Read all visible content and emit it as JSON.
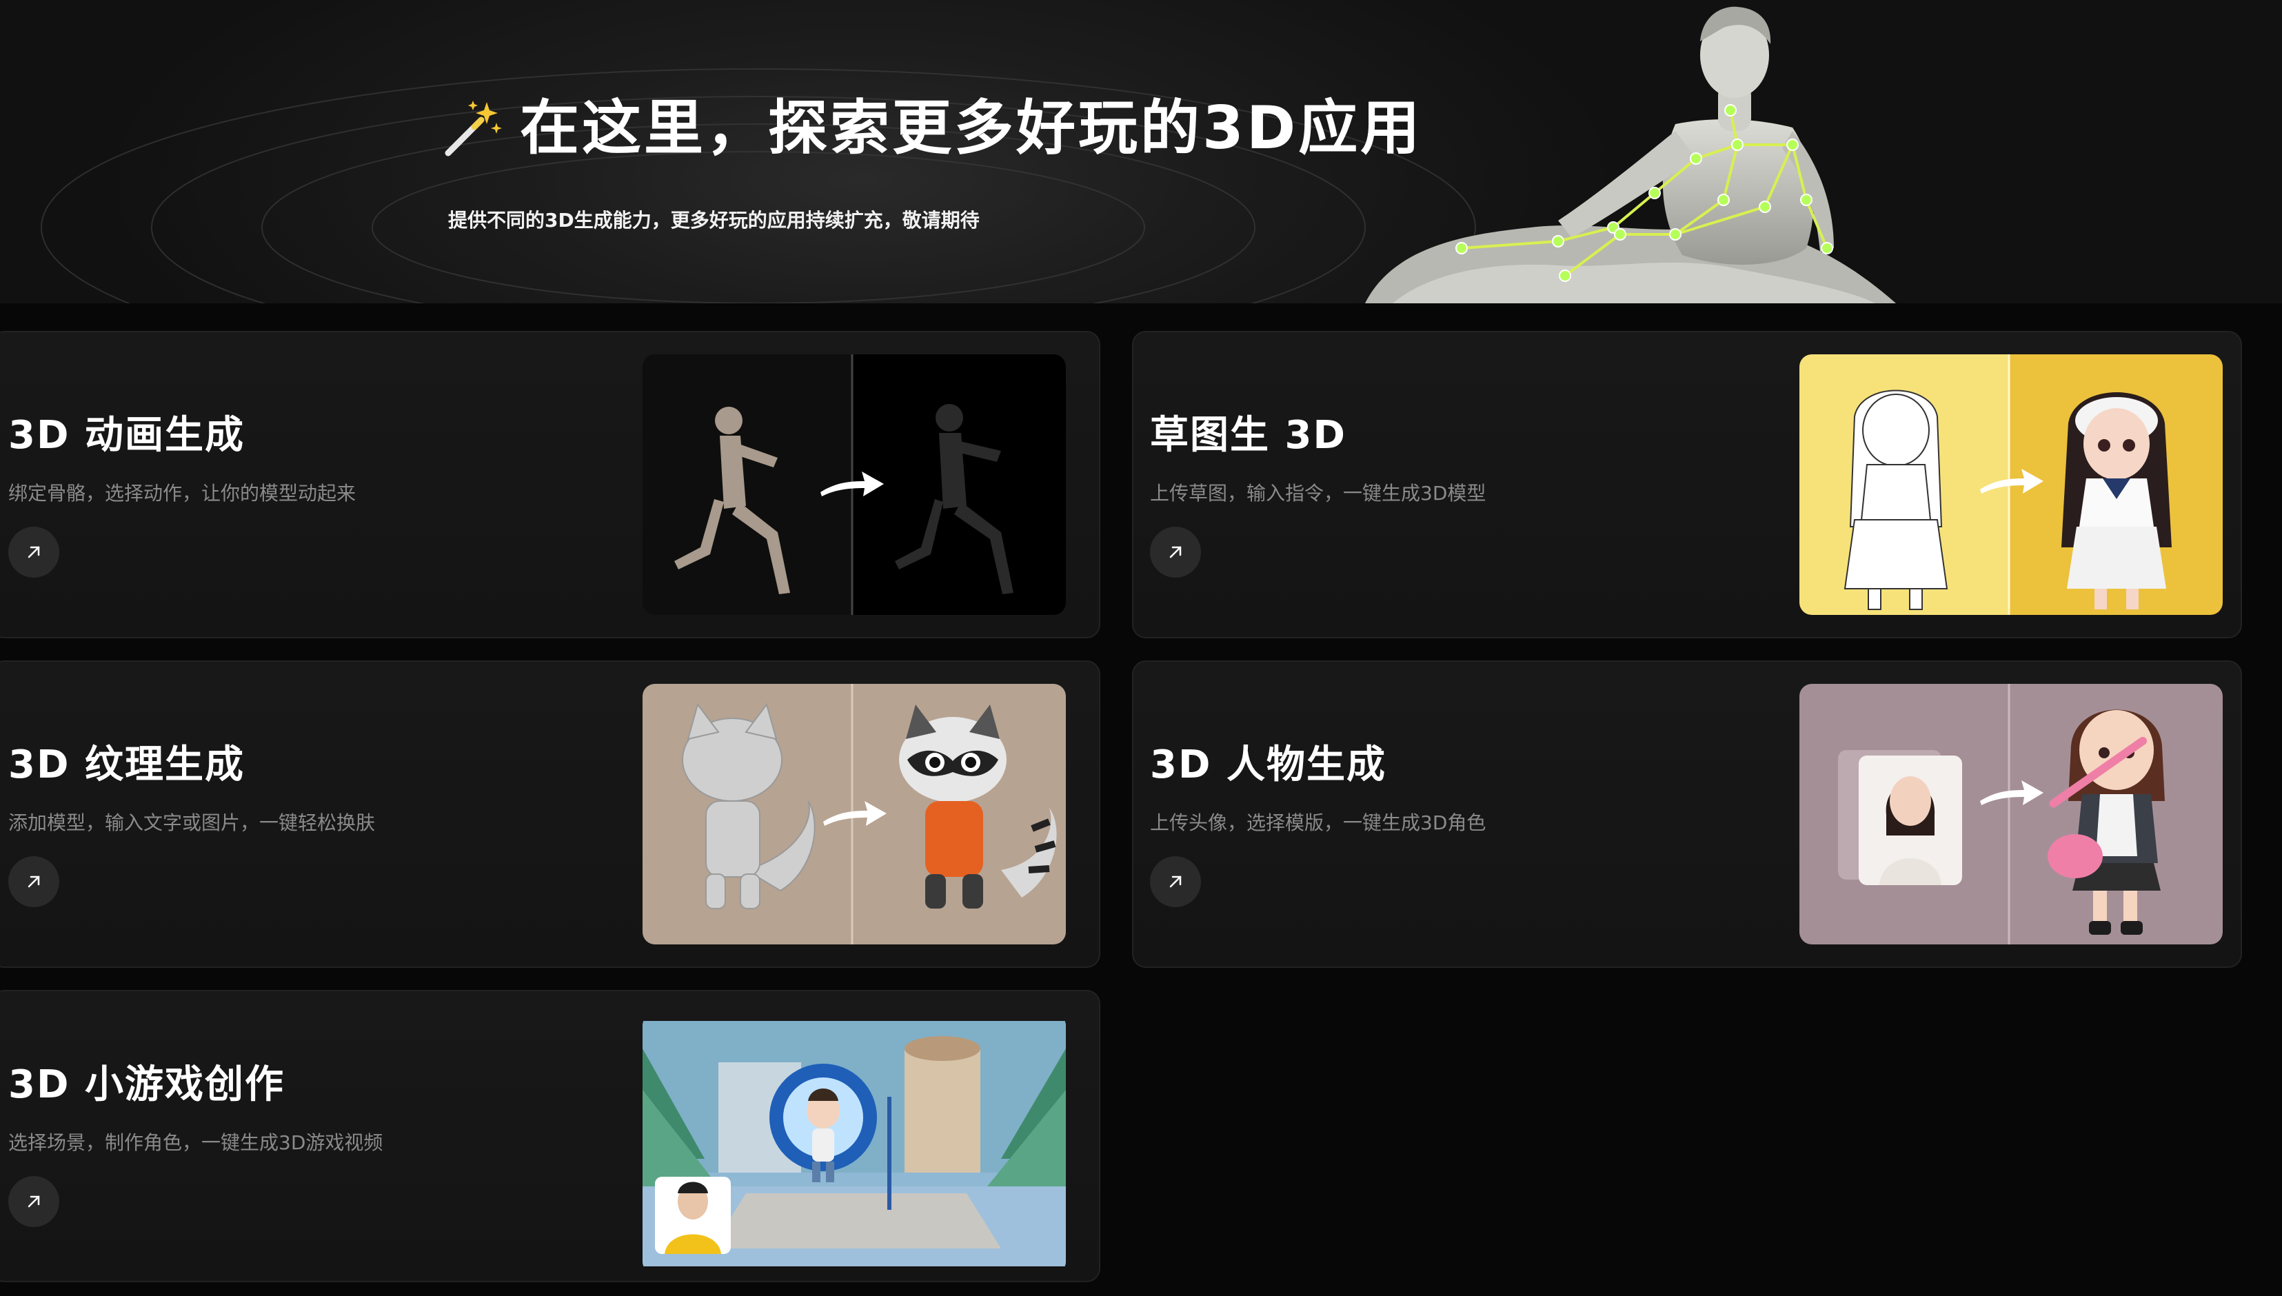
{
  "hero": {
    "title": "在这里，探索更多好玩的3D应用",
    "subtitle": "提供不同的3D生成能力，更多好玩的应用持续扩充，敬请期待",
    "wand_icon": "magic-wand-icon",
    "statue_image": "statue-skeleton-illustration"
  },
  "cards": [
    {
      "title": "3D 动画生成",
      "desc": "绑定骨骼，选择动作，让你的模型动起来",
      "icon": "arrow-up-right-icon",
      "image": "animation-before-after"
    },
    {
      "title": "草图生 3D",
      "desc": "上传草图，输入指令，一键生成3D模型",
      "icon": "arrow-up-right-icon",
      "image": "sketch-to-3d-before-after"
    },
    {
      "title": "3D 纹理生成",
      "desc": "添加模型，输入文字或图片，一键轻松换肤",
      "icon": "arrow-up-right-icon",
      "image": "texture-before-after"
    },
    {
      "title": "3D 人物生成",
      "desc": "上传头像，选择模版，一键生成3D角色",
      "icon": "arrow-up-right-icon",
      "image": "character-before-after"
    },
    {
      "title": "3D 小游戏创作",
      "desc": "选择场景，制作角色，一键生成3D游戏视频",
      "icon": "arrow-up-right-icon",
      "image": "mini-game-scene"
    }
  ],
  "colors": {
    "background": "#070707",
    "card": "#161616",
    "skeleton": "#d8f050",
    "desc_text": "#8a8a8a"
  }
}
